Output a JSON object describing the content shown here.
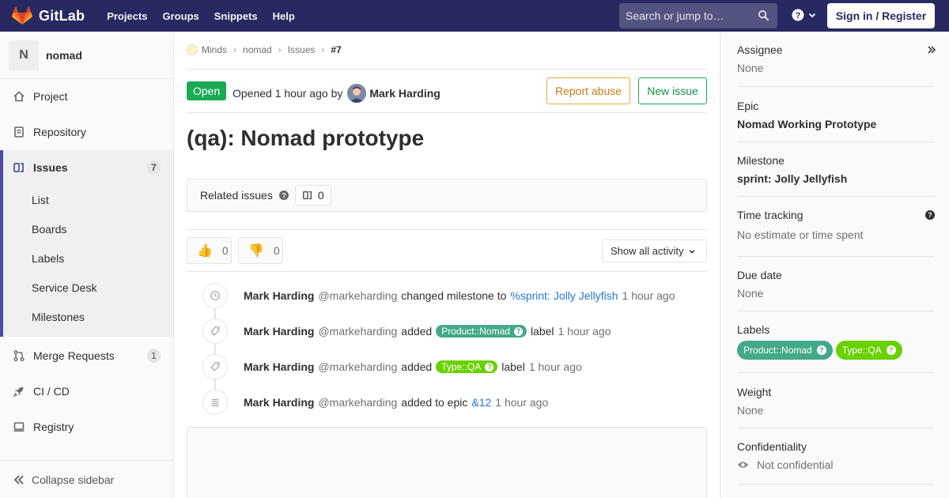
{
  "navbar": {
    "brand": "GitLab",
    "links": [
      "Projects",
      "Groups",
      "Snippets",
      "Help"
    ],
    "search_placeholder": "Search or jump to…",
    "signin_label": "Sign in / Register"
  },
  "sidebar": {
    "project_initial": "N",
    "project_name": "nomad",
    "items": [
      {
        "label": "Project",
        "icon": "home-icon"
      },
      {
        "label": "Repository",
        "icon": "doc-icon"
      },
      {
        "label": "Issues",
        "icon": "issues-icon",
        "count": "7"
      },
      {
        "label": "Merge Requests",
        "icon": "merge-icon",
        "count": "1"
      },
      {
        "label": "CI / CD",
        "icon": "rocket-icon"
      },
      {
        "label": "Registry",
        "icon": "registry-icon"
      }
    ],
    "issue_subitems": [
      "List",
      "Boards",
      "Labels",
      "Service Desk",
      "Milestones"
    ],
    "collapse_label": "Collapse sidebar"
  },
  "breadcrumb": [
    "Minds",
    "nomad",
    "Issues",
    "#7"
  ],
  "issue": {
    "status": "Open",
    "opened_prefix": "Opened",
    "opened_time": "1 hour ago",
    "by": "by",
    "author": "Mark Harding",
    "report_abuse": "Report abuse",
    "new_issue": "New issue",
    "title": "(qa): Nomad prototype",
    "related_label": "Related issues",
    "related_count": "0",
    "thumbs_up": "0",
    "thumbs_down": "0",
    "activity_filter": "Show all activity"
  },
  "notes": [
    {
      "who": "Mark Harding",
      "handle": "@markeharding",
      "action": "changed milestone to",
      "link": "%sprint: Jolly Jellyfish",
      "time": "1 hour ago"
    },
    {
      "who": "Mark Harding",
      "handle": "@markeharding",
      "action": "added",
      "label": "Product::Nomad",
      "after": "label",
      "time": "1 hour ago"
    },
    {
      "who": "Mark Harding",
      "handle": "@markeharding",
      "action": "added",
      "label": "Type::QA",
      "after": "label",
      "time": "1 hour ago"
    },
    {
      "who": "Mark Harding",
      "handle": "@markeharding",
      "action": "added to epic",
      "link": "&12",
      "time": "1 hour ago"
    }
  ],
  "right": {
    "assignee_title": "Assignee",
    "assignee_value": "None",
    "epic_title": "Epic",
    "epic_value": "Nomad Working Prototype",
    "milestone_title": "Milestone",
    "milestone_value": "sprint: Jolly Jellyfish",
    "time_title": "Time tracking",
    "time_value": "No estimate or time spent",
    "due_title": "Due date",
    "due_value": "None",
    "labels_title": "Labels",
    "labels": [
      "Product::Nomad",
      "Type::QA"
    ],
    "weight_title": "Weight",
    "weight_value": "None",
    "conf_title": "Confidentiality",
    "conf_value": "Not confidential"
  },
  "colors": {
    "navbar": "#292961",
    "open": "#1aaa55",
    "label_product": "#44a98a",
    "label_type": "#69d100",
    "link": "#1f78d1"
  }
}
